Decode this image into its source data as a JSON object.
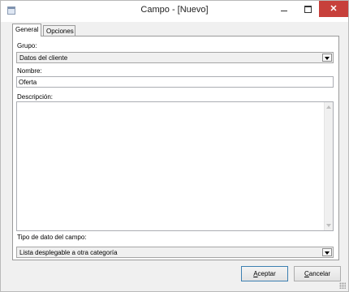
{
  "window": {
    "title": "Campo - [Nuevo]",
    "close_glyph": "✕"
  },
  "tabs": [
    {
      "label": "General",
      "active": true
    },
    {
      "label": "Opciones",
      "active": false
    }
  ],
  "form": {
    "grupo_label": "Grupo:",
    "grupo_value": "Datos del cliente",
    "nombre_label": "Nombre:",
    "nombre_value": "Oferta",
    "descripcion_label": "Descripción:",
    "descripcion_value": "",
    "tipo_label": "Tipo de dato del campo:",
    "tipo_value": "Lista desplegable a otra categoría"
  },
  "buttons": {
    "aceptar_label_u": "A",
    "aceptar_label_rest": "ceptar",
    "cancelar_label_u": "C",
    "cancelar_label_rest": "ancelar"
  },
  "colors": {
    "close_button": "#c7403b",
    "default_button_border": "#3c7fb1"
  }
}
